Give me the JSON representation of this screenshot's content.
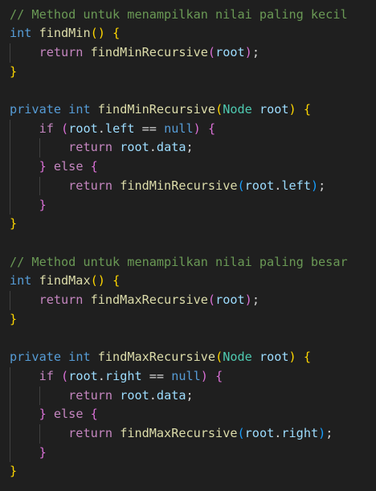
{
  "editor": {
    "lines": [
      [
        [
          "// Method untuk menampilkan nilai paling kecil",
          "t-comment"
        ]
      ],
      [
        [
          "int",
          "t-keyword"
        ],
        [
          " ",
          "t-plain"
        ],
        [
          "findMin",
          "t-function"
        ],
        [
          "()",
          "t-b1"
        ],
        [
          " ",
          "t-plain"
        ],
        [
          "{",
          "t-b1"
        ]
      ],
      [
        [
          "    ",
          "t-plain"
        ],
        [
          "return",
          "t-control"
        ],
        [
          " ",
          "t-plain"
        ],
        [
          "findMinRecursive",
          "t-function"
        ],
        [
          "(",
          "t-b2"
        ],
        [
          "root",
          "t-variable"
        ],
        [
          ")",
          "t-b2"
        ],
        [
          ";",
          "t-plain"
        ]
      ],
      [
        [
          "}",
          "t-b1"
        ]
      ],
      [],
      [
        [
          "private",
          "t-keyword"
        ],
        [
          " ",
          "t-plain"
        ],
        [
          "int",
          "t-keyword"
        ],
        [
          " ",
          "t-plain"
        ],
        [
          "findMinRecursive",
          "t-function"
        ],
        [
          "(",
          "t-b1"
        ],
        [
          "Node",
          "t-type"
        ],
        [
          " ",
          "t-plain"
        ],
        [
          "root",
          "t-variable"
        ],
        [
          ")",
          "t-b1"
        ],
        [
          " ",
          "t-plain"
        ],
        [
          "{",
          "t-b1"
        ]
      ],
      [
        [
          "    ",
          "t-plain"
        ],
        [
          "if",
          "t-control"
        ],
        [
          " ",
          "t-plain"
        ],
        [
          "(",
          "t-b2"
        ],
        [
          "root",
          "t-variable"
        ],
        [
          ".",
          "t-plain"
        ],
        [
          "left",
          "t-variable"
        ],
        [
          " == ",
          "t-plain"
        ],
        [
          "null",
          "t-keyword"
        ],
        [
          ")",
          "t-b2"
        ],
        [
          " ",
          "t-plain"
        ],
        [
          "{",
          "t-b2"
        ]
      ],
      [
        [
          "        ",
          "t-plain"
        ],
        [
          "return",
          "t-control"
        ],
        [
          " ",
          "t-plain"
        ],
        [
          "root",
          "t-variable"
        ],
        [
          ".",
          "t-plain"
        ],
        [
          "data",
          "t-variable"
        ],
        [
          ";",
          "t-plain"
        ]
      ],
      [
        [
          "    ",
          "t-plain"
        ],
        [
          "}",
          "t-b2"
        ],
        [
          " ",
          "t-plain"
        ],
        [
          "else",
          "t-control"
        ],
        [
          " ",
          "t-plain"
        ],
        [
          "{",
          "t-b2"
        ]
      ],
      [
        [
          "        ",
          "t-plain"
        ],
        [
          "return",
          "t-control"
        ],
        [
          " ",
          "t-plain"
        ],
        [
          "findMinRecursive",
          "t-function"
        ],
        [
          "(",
          "t-b3"
        ],
        [
          "root",
          "t-variable"
        ],
        [
          ".",
          "t-plain"
        ],
        [
          "left",
          "t-variable"
        ],
        [
          ")",
          "t-b3"
        ],
        [
          ";",
          "t-plain"
        ]
      ],
      [
        [
          "    ",
          "t-plain"
        ],
        [
          "}",
          "t-b2"
        ]
      ],
      [
        [
          "}",
          "t-b1"
        ]
      ],
      [],
      [
        [
          "// Method untuk menampilkan nilai paling besar",
          "t-comment"
        ]
      ],
      [
        [
          "int",
          "t-keyword"
        ],
        [
          " ",
          "t-plain"
        ],
        [
          "findMax",
          "t-function"
        ],
        [
          "()",
          "t-b1"
        ],
        [
          " ",
          "t-plain"
        ],
        [
          "{",
          "t-b1"
        ]
      ],
      [
        [
          "    ",
          "t-plain"
        ],
        [
          "return",
          "t-control"
        ],
        [
          " ",
          "t-plain"
        ],
        [
          "findMaxRecursive",
          "t-function"
        ],
        [
          "(",
          "t-b2"
        ],
        [
          "root",
          "t-variable"
        ],
        [
          ")",
          "t-b2"
        ],
        [
          ";",
          "t-plain"
        ]
      ],
      [
        [
          "}",
          "t-b1"
        ]
      ],
      [],
      [
        [
          "private",
          "t-keyword"
        ],
        [
          " ",
          "t-plain"
        ],
        [
          "int",
          "t-keyword"
        ],
        [
          " ",
          "t-plain"
        ],
        [
          "findMaxRecursive",
          "t-function"
        ],
        [
          "(",
          "t-b1"
        ],
        [
          "Node",
          "t-type"
        ],
        [
          " ",
          "t-plain"
        ],
        [
          "root",
          "t-variable"
        ],
        [
          ")",
          "t-b1"
        ],
        [
          " ",
          "t-plain"
        ],
        [
          "{",
          "t-b1"
        ]
      ],
      [
        [
          "    ",
          "t-plain"
        ],
        [
          "if",
          "t-control"
        ],
        [
          " ",
          "t-plain"
        ],
        [
          "(",
          "t-b2"
        ],
        [
          "root",
          "t-variable"
        ],
        [
          ".",
          "t-plain"
        ],
        [
          "right",
          "t-variable"
        ],
        [
          " == ",
          "t-plain"
        ],
        [
          "null",
          "t-keyword"
        ],
        [
          ")",
          "t-b2"
        ],
        [
          " ",
          "t-plain"
        ],
        [
          "{",
          "t-b2"
        ]
      ],
      [
        [
          "        ",
          "t-plain"
        ],
        [
          "return",
          "t-control"
        ],
        [
          " ",
          "t-plain"
        ],
        [
          "root",
          "t-variable"
        ],
        [
          ".",
          "t-plain"
        ],
        [
          "data",
          "t-variable"
        ],
        [
          ";",
          "t-plain"
        ]
      ],
      [
        [
          "    ",
          "t-plain"
        ],
        [
          "}",
          "t-b2"
        ],
        [
          " ",
          "t-plain"
        ],
        [
          "else",
          "t-control"
        ],
        [
          " ",
          "t-plain"
        ],
        [
          "{",
          "t-b2"
        ]
      ],
      [
        [
          "        ",
          "t-plain"
        ],
        [
          "return",
          "t-control"
        ],
        [
          " ",
          "t-plain"
        ],
        [
          "findMaxRecursive",
          "t-function"
        ],
        [
          "(",
          "t-b3"
        ],
        [
          "root",
          "t-variable"
        ],
        [
          ".",
          "t-plain"
        ],
        [
          "right",
          "t-variable"
        ],
        [
          ")",
          "t-b3"
        ],
        [
          ";",
          "t-plain"
        ]
      ],
      [
        [
          "    ",
          "t-plain"
        ],
        [
          "}",
          "t-b2"
        ]
      ],
      [
        [
          "}",
          "t-b1"
        ]
      ]
    ]
  },
  "colors": {
    "background": "#1f1f1f",
    "comment": "#6a9955",
    "keyword": "#569cd6",
    "control": "#c586c0",
    "function": "#dcdcaa",
    "type": "#4ec9b0",
    "variable": "#9cdcfe",
    "plain": "#d4d4d4",
    "bracket_level_1": "#ffd700",
    "bracket_level_2": "#da70d6",
    "bracket_level_3": "#179fff",
    "indent_guide": "#404040"
  }
}
